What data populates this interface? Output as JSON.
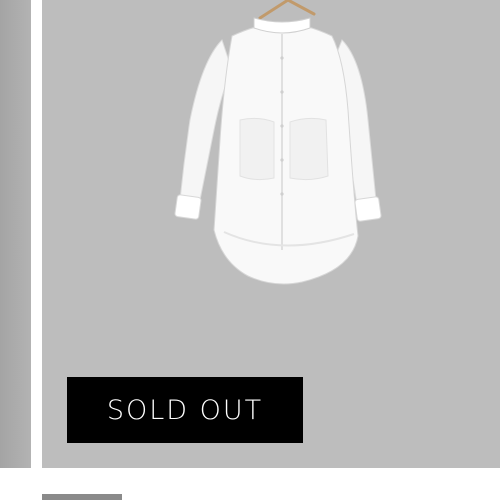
{
  "product": {
    "status_badge": "SOLD OUT",
    "image_icon": "white-shirt-jacket-on-hanger-icon"
  },
  "colors": {
    "card_background": "#bdbdbd",
    "badge_background": "#000000",
    "badge_text": "#ffffff"
  }
}
